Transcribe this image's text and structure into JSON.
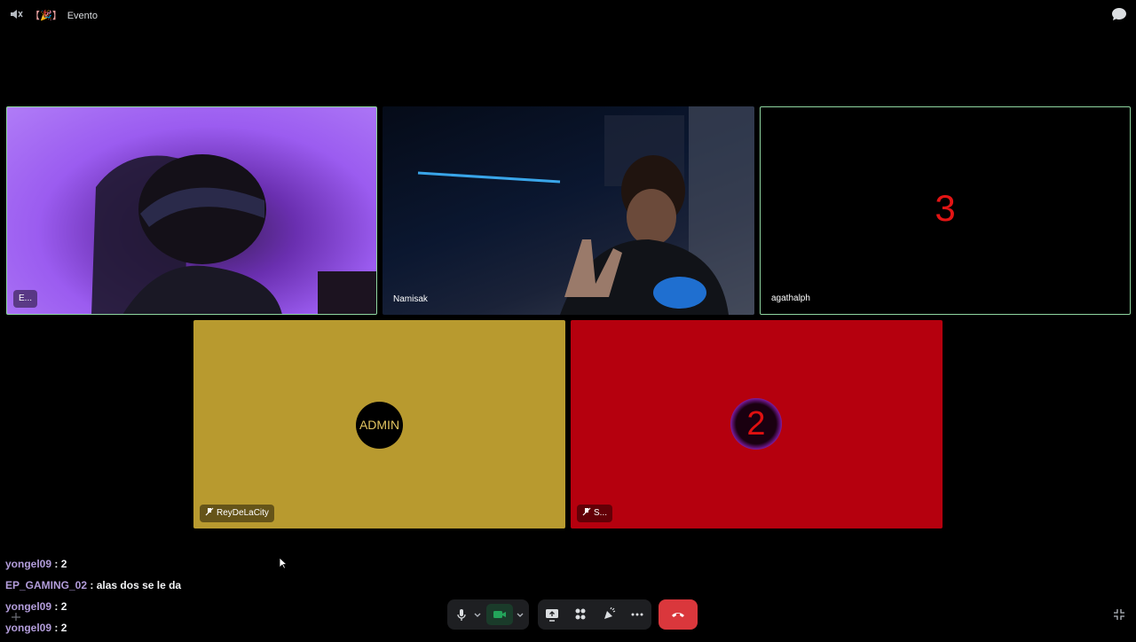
{
  "window": {
    "title_emoji": "【🎉】",
    "title": "Evento"
  },
  "tiles": {
    "e": {
      "name": "E..."
    },
    "namisak": {
      "name": "Namisak"
    },
    "agatha": {
      "name": "agathalph",
      "number": "3"
    },
    "rey": {
      "name": "ReyDeLaCity",
      "avatar_text": "ADMIN"
    },
    "s": {
      "name": "S...",
      "avatar_text": "2"
    }
  },
  "chat": [
    {
      "user": "yongel09",
      "text": ": 2"
    },
    {
      "user": "EP_GAMING_02",
      "text": ": alas dos se le da"
    },
    {
      "user": "yongel09",
      "text": ": 2"
    },
    {
      "user": "yongel09",
      "text": ": 2"
    }
  ],
  "colors": {
    "tile_rey_bg": "#b89a2f",
    "tile_s_bg": "#b5000e",
    "speaking_border": "#8fd6a0",
    "hangup": "#da373c",
    "chat_user": "#b39ddb"
  },
  "icons": [
    "speaker-icon",
    "chat-bubble-icon",
    "microphone-icon",
    "chevron-down-icon",
    "camera-icon",
    "screen-share-icon",
    "activities-icon",
    "soundboard-icon",
    "more-icon",
    "hang-up-icon",
    "fullscreen-exit-icon",
    "muted-mic-icon"
  ]
}
